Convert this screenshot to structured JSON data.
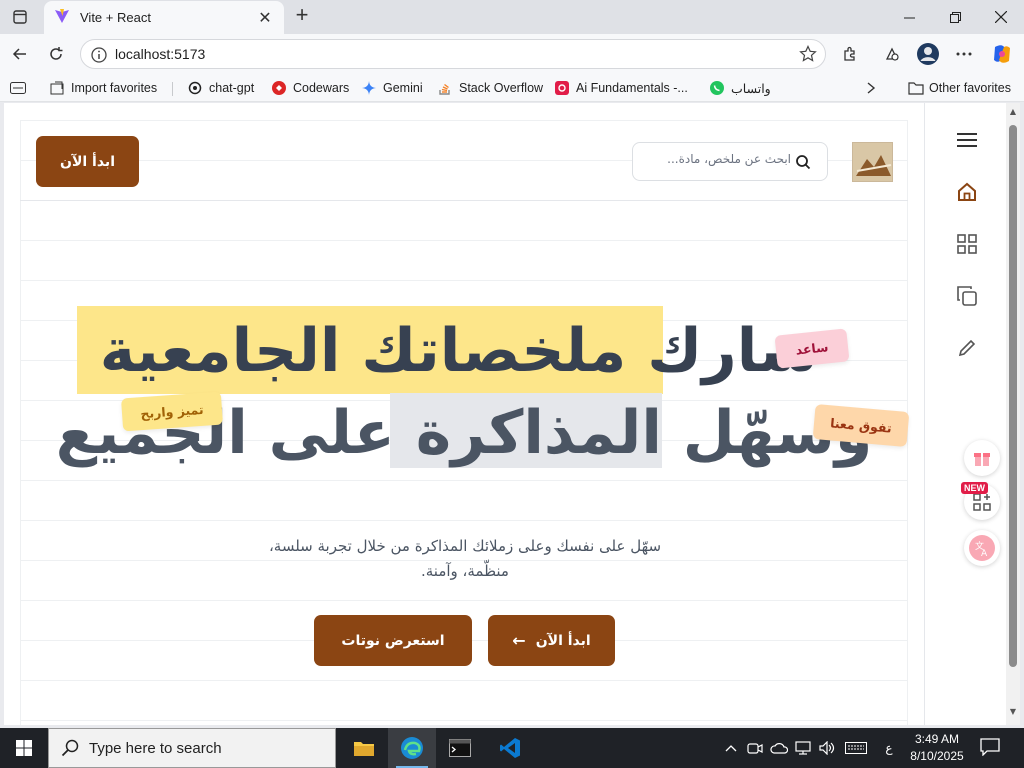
{
  "browser": {
    "tab_title": "Vite + React",
    "url": "localhost:5173",
    "favorites": [
      {
        "label": "Import favorites",
        "icon": "import-icon"
      },
      {
        "label": "chat-gpt",
        "icon": "chatgpt-icon"
      },
      {
        "label": "Codewars",
        "icon": "codewars-icon"
      },
      {
        "label": "Gemini",
        "icon": "gemini-icon"
      },
      {
        "label": "Stack Overflow",
        "icon": "stackoverflow-icon"
      },
      {
        "label": "Ai Fundamentals -...",
        "icon": "ai-fundamentals-icon"
      },
      {
        "label": "واتساب",
        "icon": "whatsapp-icon"
      }
    ],
    "other_favorites": "Other favorites"
  },
  "page": {
    "cta_top": "ابدأ الآن",
    "search_placeholder": "ابحث عن ملخص، مادة...",
    "headline_line1": "شارك ملخصاتك الجامعية",
    "headline_line2": "وسهّل المذاكرة على الجميع",
    "tag_help": "ساعد",
    "tag_excel": "تفوق معنا",
    "tag_win": "تميز واربح",
    "subtitle_line1": "سهّل على نفسك وعلى زملائك المذاكرة من خلال تجربة سلسة،",
    "subtitle_line2": "منظّمة، وآمنة.",
    "btn_start": "ابدأ الآن",
    "btn_browse": "استعرض نوتات",
    "new_badge": "NEW",
    "sidebar_icons": [
      "menu-icon",
      "home-icon",
      "grid-icon",
      "copy-icon",
      "pencil-icon"
    ]
  },
  "taskbar": {
    "search_placeholder": "Type here to search",
    "time": "3:49 AM",
    "date": "8/10/2025",
    "lang": "ع"
  },
  "colors": {
    "brand_brown": "#8b4513",
    "highlight_yellow": "#fde68a",
    "highlight_gray": "#e5e7eb"
  }
}
